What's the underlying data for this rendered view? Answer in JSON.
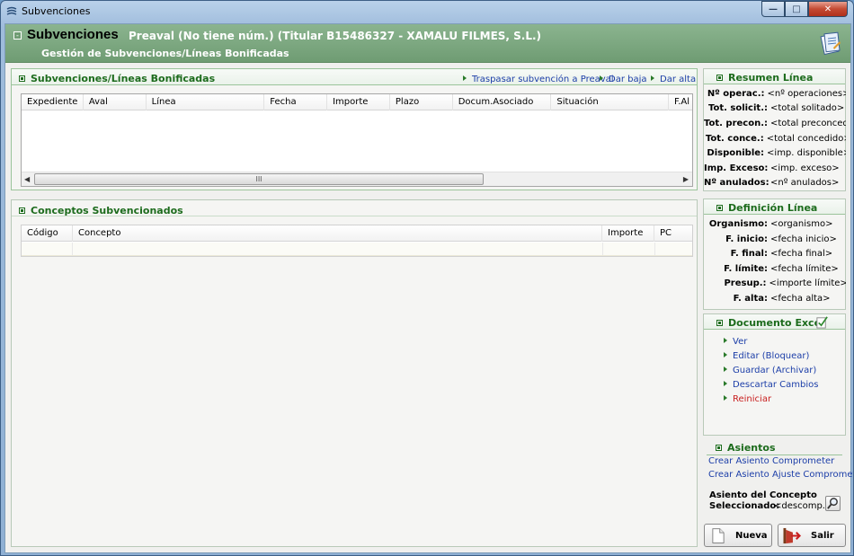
{
  "window": {
    "title": "Subvenciones"
  },
  "header": {
    "title": "Subvenciones",
    "info": "Preaval (No tiene núm.) (Titular B15486327 - XAMALU FILMES, S.L.)",
    "subtitle": "Gestión de Subvenciones/Líneas Bonificadas"
  },
  "lineas": {
    "title": "Subvenciones/Líneas Bonificadas",
    "links": [
      "Traspasar subvención a Preaval",
      "Dar baja",
      "Dar alta"
    ],
    "columns": [
      "Expediente",
      "Aval",
      "Línea",
      "Fecha",
      "Importe",
      "Plazo",
      "Docum.Asociado",
      "Situación",
      "F.Al"
    ],
    "rows": [],
    "scroll_thumb": "III"
  },
  "conceptos": {
    "title": "Conceptos Subvencionados",
    "columns": [
      "Código",
      "Concepto",
      "Importe",
      "PC"
    ],
    "rows": []
  },
  "resumen": {
    "title": "Resumen Línea",
    "items": [
      {
        "label": "Nº operac.:",
        "value": "<nº operaciones>"
      },
      {
        "label": "Tot. solicit.:",
        "value": "<total solitado>"
      },
      {
        "label": "Tot. precon.:",
        "value": "<total preconced.>"
      },
      {
        "label": "Tot. conce.:",
        "value": "<total concedido>"
      },
      {
        "label": "Disponible:",
        "value": "<imp. disponible>"
      },
      {
        "label": "Imp. Exceso:",
        "value": "<imp. exceso>"
      },
      {
        "label": "Nº anulados:",
        "value": "<nº anulados>"
      }
    ]
  },
  "definicion": {
    "title": "Definición Línea",
    "items": [
      {
        "label": "Organismo:",
        "value": "<organismo>"
      },
      {
        "label": "F. inicio:",
        "value": "<fecha inicio>"
      },
      {
        "label": "F. final:",
        "value": "<fecha final>"
      },
      {
        "label": "F. límite:",
        "value": "<fecha límite>"
      },
      {
        "label": "Presup.:",
        "value": "<importe límite>"
      },
      {
        "label": "F. alta:",
        "value": "<fecha alta>"
      }
    ]
  },
  "excel": {
    "title": "Documento Excel",
    "actions": [
      "Ver",
      "Editar (Bloquear)",
      "Guardar (Archivar)",
      "Descartar Cambios",
      "Reiniciar"
    ]
  },
  "asientos": {
    "title": "Asientos",
    "links": [
      "Crear Asiento Comprometer",
      "Crear Asiento Ajuste Comprometido"
    ],
    "concepto_label_1": "Asiento del Concepto",
    "concepto_label_2": "Seleccionado:",
    "concepto_value": "<descomp..."
  },
  "buttons": {
    "nueva": "Nueva",
    "salir": "Salir"
  }
}
